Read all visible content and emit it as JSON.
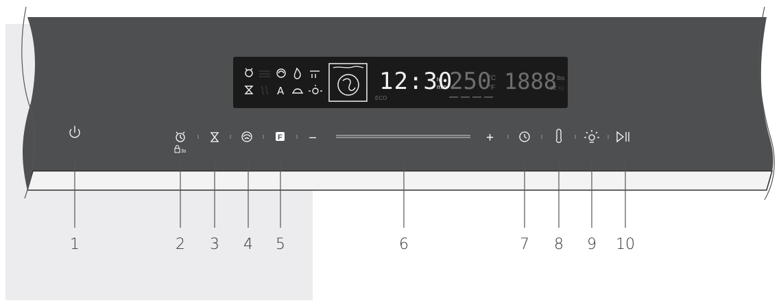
{
  "colors": {
    "panel": "#4d4f50",
    "panel_edge": "#2f3132",
    "display_bg": "#1a1a1a",
    "display_on": "#f2f2f2",
    "display_dim": "#3a3a3a",
    "callout_bg": "#ececee",
    "line": "#555555",
    "icon": "#ffffff"
  },
  "display": {
    "time": "12:30",
    "time_unit_top": "hr",
    "time_unit_bottom": "min",
    "temperature": "250",
    "temp_unit_c": "°C",
    "temp_unit_f": "°F",
    "weight": "1888",
    "weight_unit_lbs": "lbs",
    "weight_unit_oz": "oz",
    "weight_unit_kg": "kg",
    "eco_label": "ECO"
  },
  "controls": {
    "lock_hint": "3s",
    "minus": "–",
    "plus": "+",
    "function_key": "F",
    "mode_auto": "A"
  },
  "callouts": [
    "1",
    "2",
    "3",
    "4",
    "5",
    "6",
    "7",
    "8",
    "9",
    "10"
  ]
}
